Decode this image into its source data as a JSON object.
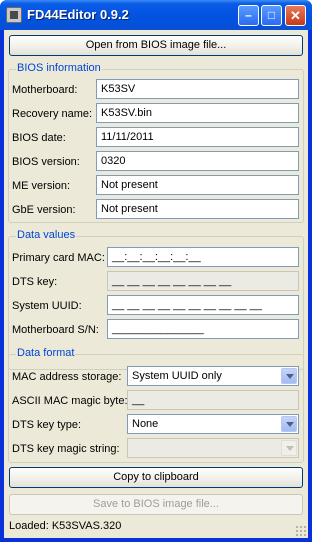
{
  "window": {
    "title": "FD44Editor 0.9.2",
    "minimize": "–",
    "maximize": "□",
    "close": "✕"
  },
  "open_button": "Open from BIOS image file...",
  "bios_info": {
    "title": "BIOS information",
    "motherboard_label": "Motherboard:",
    "motherboard_value": "K53SV",
    "recovery_label": "Recovery name:",
    "recovery_value": "K53SV.bin",
    "date_label": "BIOS date:",
    "date_value": "11/11/2011",
    "version_label": "BIOS version:",
    "version_value": "0320",
    "me_label": "ME version:",
    "me_value": "Not present",
    "gbe_label": "GbE version:",
    "gbe_value": "Not present"
  },
  "data_values": {
    "title": "Data values",
    "mac_label": "Primary card MAC:",
    "mac_value": "__:__:__:__:__:__",
    "dts_label": "DTS key:",
    "dts_value": "__ __ __ __ __ __ __ __",
    "uuid_label": "System UUID:",
    "uuid_value": "__ __ __ __ __ __ __ __ __ __",
    "sn_label": "Motherboard S/N:",
    "sn_value": "_______________"
  },
  "data_format": {
    "title": "Data format",
    "mac_storage_label": "MAC address storage:",
    "mac_storage_value": "System UUID only",
    "ascii_label": "ASCII MAC magic byte:",
    "ascii_value": "__",
    "dts_type_label": "DTS key type:",
    "dts_type_value": "None",
    "dts_magic_label": "DTS key magic string:",
    "dts_magic_value": ""
  },
  "copy_button": "Copy to clipboard",
  "save_button": "Save to BIOS image file...",
  "status": "Loaded: K53SVAS.320"
}
